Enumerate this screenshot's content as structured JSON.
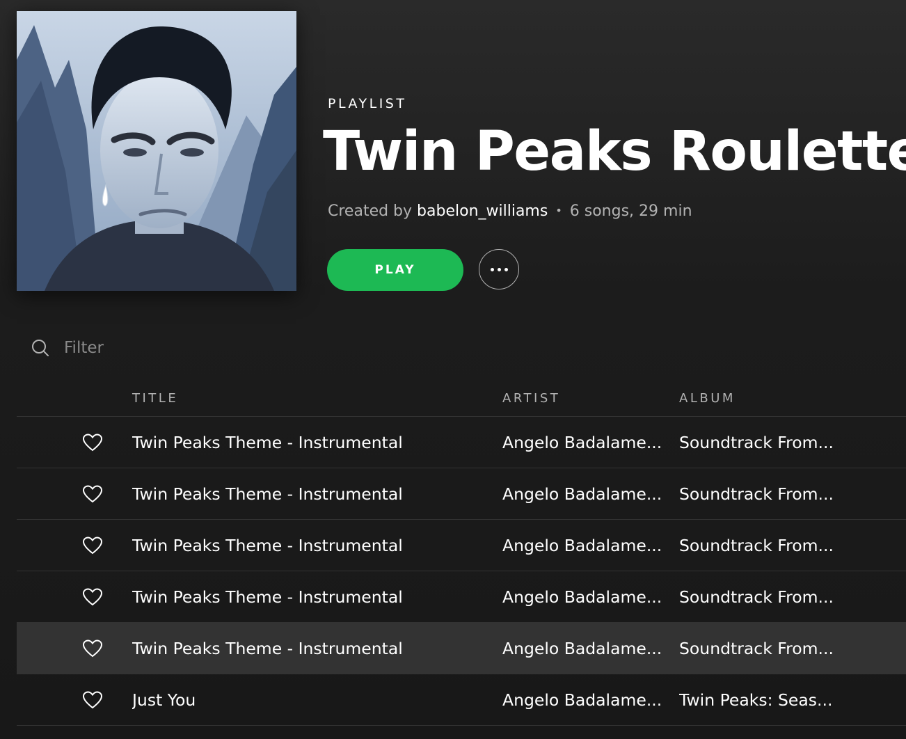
{
  "header": {
    "kind": "PLAYLIST",
    "title": "Twin Peaks Roulette",
    "created_by_label": "Created by",
    "owner": "babelon_williams",
    "separator": "•",
    "stats": "6 songs, 29 min",
    "play_label": "PLAY",
    "more_icon": "ellipsis-icon"
  },
  "cover": {
    "icon": "playlist-cover-image"
  },
  "filter": {
    "placeholder": "Filter",
    "value": "",
    "icon": "search-icon"
  },
  "columns": {
    "title": "TITLE",
    "artist": "ARTIST",
    "album": "ALBUM"
  },
  "tracks": [
    {
      "title": "Twin Peaks Theme - Instrumental",
      "artist": "Angelo Badalame...",
      "album": "Soundtrack From..."
    },
    {
      "title": "Twin Peaks Theme - Instrumental",
      "artist": "Angelo Badalame...",
      "album": "Soundtrack From..."
    },
    {
      "title": "Twin Peaks Theme - Instrumental",
      "artist": "Angelo Badalame...",
      "album": "Soundtrack From..."
    },
    {
      "title": "Twin Peaks Theme - Instrumental",
      "artist": "Angelo Badalame...",
      "album": "Soundtrack From..."
    },
    {
      "title": "Twin Peaks Theme - Instrumental",
      "artist": "Angelo Badalame...",
      "album": "Soundtrack From..."
    },
    {
      "title": "Just You",
      "artist": "Angelo Badalame...",
      "album": "Twin Peaks: Seas..."
    }
  ],
  "colors": {
    "accent": "#1db954",
    "background": "#181818",
    "row_highlight": "#333333",
    "muted_text": "#b3b3b3"
  }
}
